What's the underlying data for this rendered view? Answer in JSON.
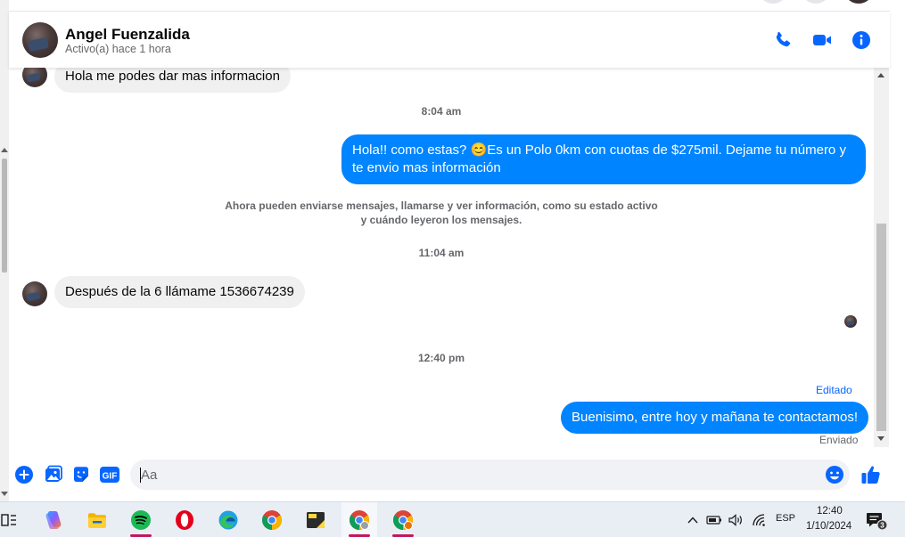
{
  "contact": {
    "name": "Angel Fuenzalida",
    "status": "Activo(a) hace 1 hora"
  },
  "messages": {
    "partial_incoming": "Hola me podes dar mas informacion",
    "ts_1": "8:04 am",
    "outgoing_1_text": "Hola!! como estas? 😊Es un Polo 0km con cuotas de $275mil. Dejame tu número y te envio mas información",
    "system_note": "Ahora pueden enviarse mensajes, llamarse y ver información, como su estado activo y cuándo leyeron los mensajes.",
    "ts_2": "11:04 am",
    "incoming_2": "Después de la 6 llámame 1536674239",
    "ts_3": "12:40 pm",
    "edited_label": "Editado",
    "outgoing_2": "Buenisimo, entre hoy y mañana te contactamos!",
    "sent_label": "Enviado"
  },
  "composer": {
    "placeholder": "Aa",
    "gif_label": "GIF"
  },
  "taskbar": {
    "language": "ESP",
    "time": "12:40",
    "date": "1/10/2024",
    "notification_count": "3",
    "apps": [
      "task-view",
      "copilot",
      "file-explorer",
      "spotify",
      "opera",
      "edge",
      "chrome",
      "sticky-notes",
      "chrome-profile-1",
      "chrome-profile-2"
    ]
  },
  "colors": {
    "accent": "#0084ff",
    "incoming_bubble": "#f0f0f0",
    "messenger_blue": "#0866ff"
  }
}
